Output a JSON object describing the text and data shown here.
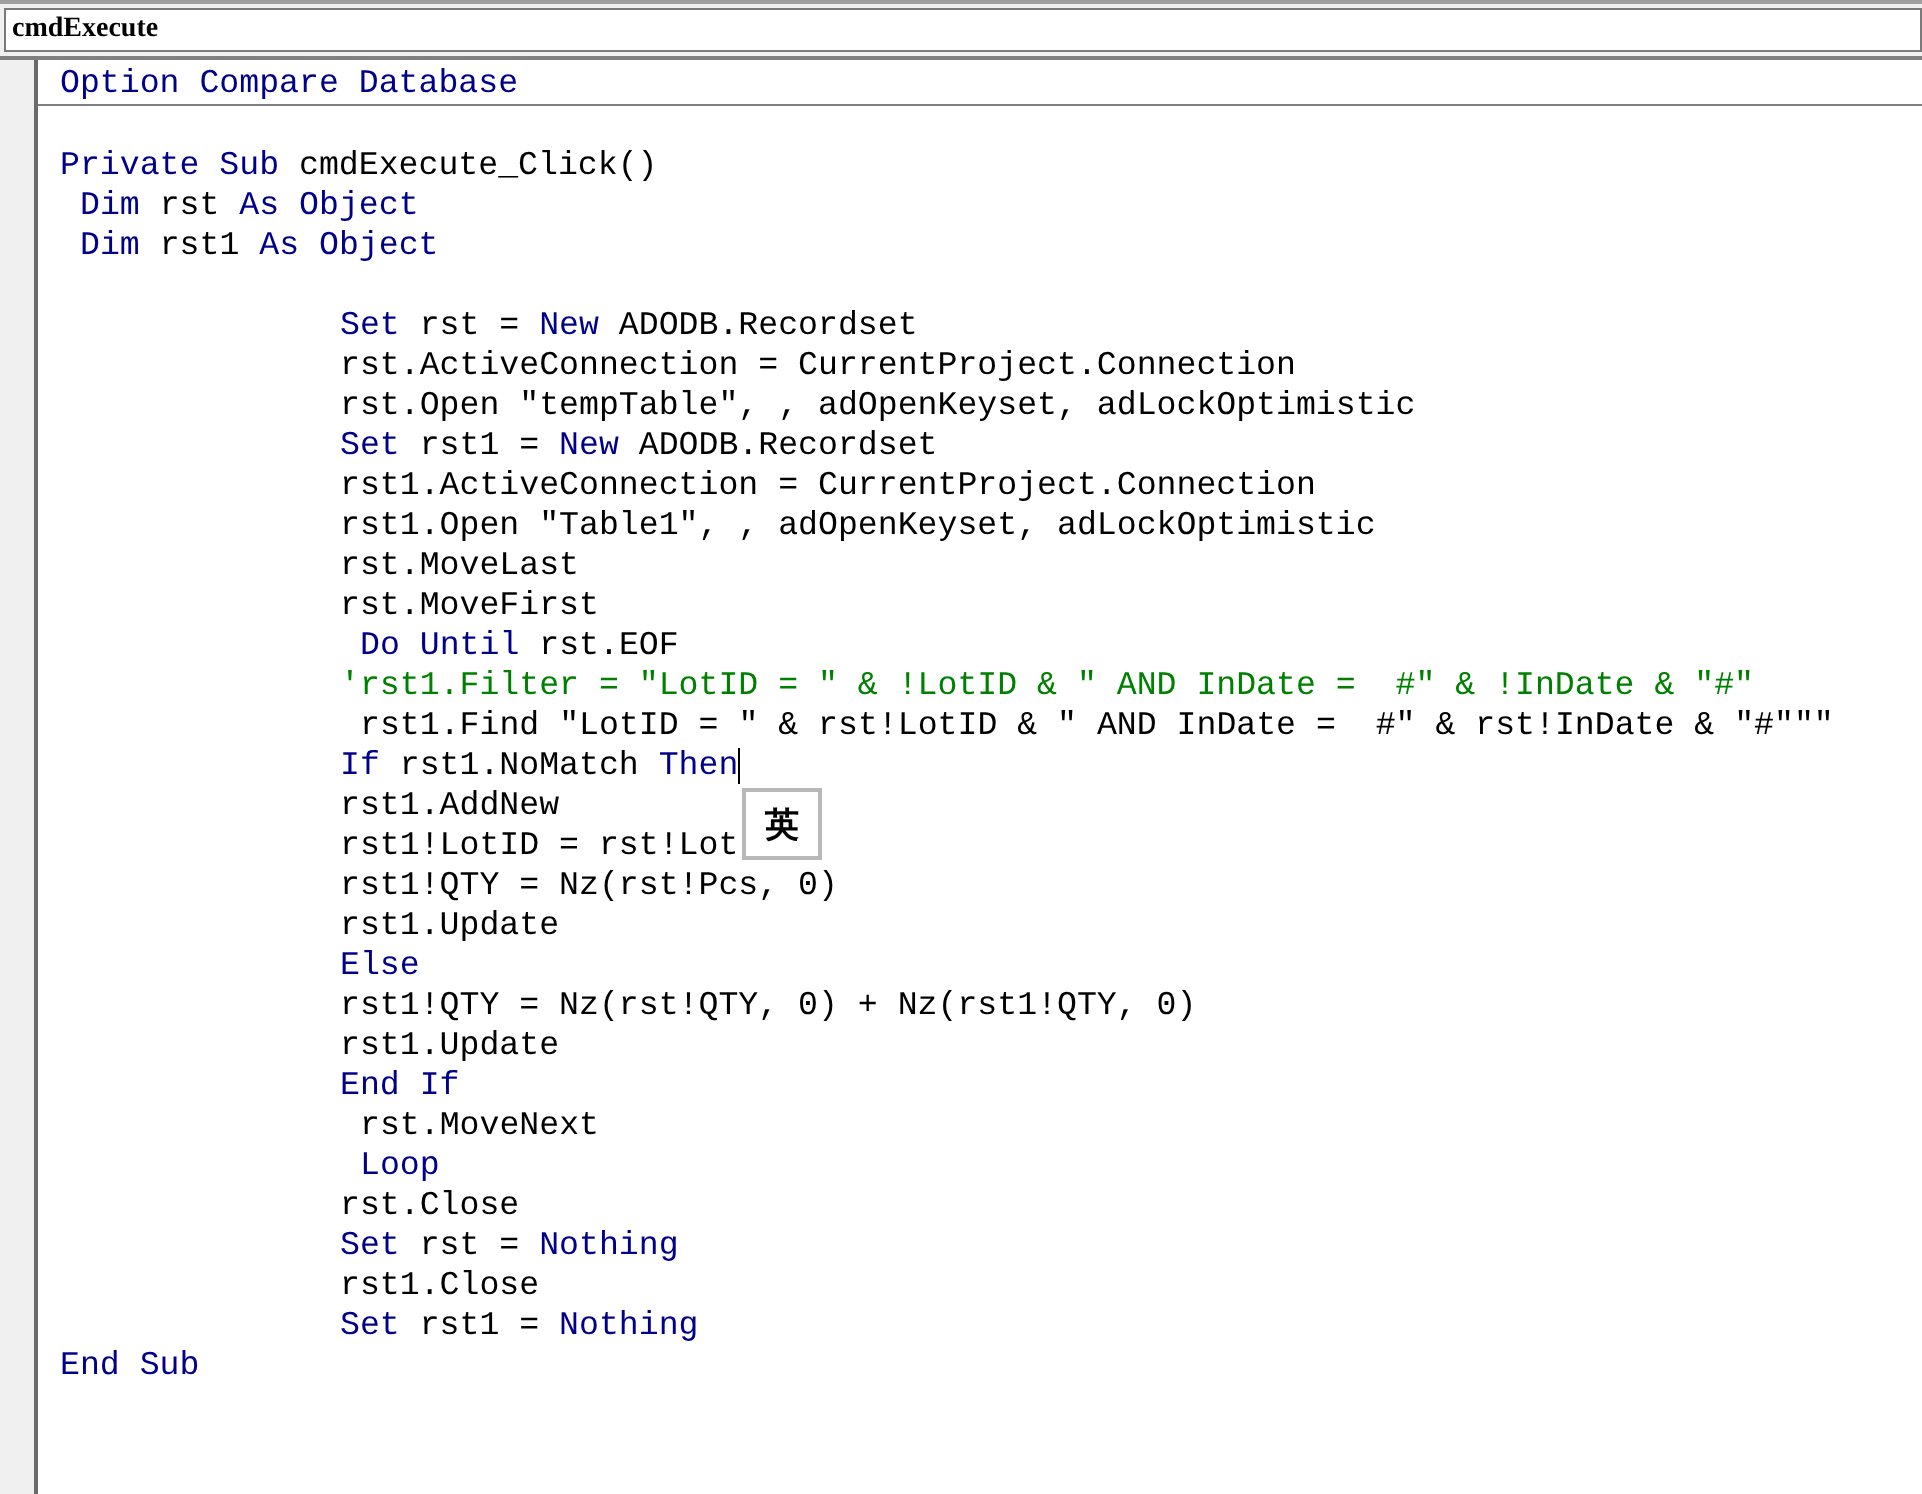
{
  "object_box": {
    "value": "cmdExecute"
  },
  "code": {
    "declarations": [
      {
        "kind": "top",
        "tokens": [
          {
            "kind": "keyword",
            "text": "Option Compare Database"
          }
        ]
      }
    ],
    "blocks": [
      {
        "lines": [
          {
            "kind": "top",
            "tokens": [
              {
                "kind": "keyword",
                "text": "Private Sub"
              },
              {
                "kind": "plain",
                "text": " cmdExecute_Click()"
              }
            ]
          },
          {
            "kind": "dim",
            "tokens": [
              {
                "kind": "keyword",
                "text": "Dim"
              },
              {
                "kind": "plain",
                "text": " rst "
              },
              {
                "kind": "keyword",
                "text": "As Object"
              }
            ]
          },
          {
            "kind": "dim",
            "tokens": [
              {
                "kind": "keyword",
                "text": "Dim"
              },
              {
                "kind": "plain",
                "text": " rst1 "
              },
              {
                "kind": "keyword",
                "text": "As Object"
              }
            ]
          }
        ]
      },
      {
        "lines": [
          {
            "kind": "body",
            "tokens": [
              {
                "kind": "keyword",
                "text": "Set"
              },
              {
                "kind": "plain",
                "text": " rst = "
              },
              {
                "kind": "keyword",
                "text": "New"
              },
              {
                "kind": "plain",
                "text": " ADODB.Recordset"
              }
            ]
          },
          {
            "kind": "body",
            "tokens": [
              {
                "kind": "plain",
                "text": "rst.ActiveConnection = CurrentProject.Connection"
              }
            ]
          },
          {
            "kind": "body",
            "tokens": [
              {
                "kind": "plain",
                "text": "rst.Open \"tempTable\", , adOpenKeyset, adLockOptimistic"
              }
            ]
          },
          {
            "kind": "body",
            "tokens": [
              {
                "kind": "keyword",
                "text": "Set"
              },
              {
                "kind": "plain",
                "text": " rst1 = "
              },
              {
                "kind": "keyword",
                "text": "New"
              },
              {
                "kind": "plain",
                "text": " ADODB.Recordset"
              }
            ]
          },
          {
            "kind": "body",
            "tokens": [
              {
                "kind": "plain",
                "text": "rst1.ActiveConnection = CurrentProject.Connection"
              }
            ]
          },
          {
            "kind": "body",
            "tokens": [
              {
                "kind": "plain",
                "text": "rst1.Open \"Table1\", , adOpenKeyset, adLockOptimistic"
              }
            ]
          },
          {
            "kind": "body",
            "tokens": [
              {
                "kind": "plain",
                "text": "rst.MoveLast"
              }
            ]
          },
          {
            "kind": "body",
            "tokens": [
              {
                "kind": "plain",
                "text": "rst.MoveFirst"
              }
            ]
          },
          {
            "kind": "loop",
            "tokens": [
              {
                "kind": "keyword",
                "text": "Do Until"
              },
              {
                "kind": "plain",
                "text": " rst.EOF"
              }
            ]
          },
          {
            "kind": "body",
            "tokens": [
              {
                "kind": "comment",
                "text": "'rst1.Filter = \"LotID = \" & !LotID & \" AND InDate =  #\" & !InDate & \"#\""
              }
            ]
          },
          {
            "kind": "loop",
            "tokens": [
              {
                "kind": "plain",
                "text": "rst1.Find \"LotID = \" & rst!LotID & \" AND InDate =  #\" & rst!InDate & \"#\"\"\""
              }
            ]
          },
          {
            "kind": "body",
            "caret": true,
            "tokens": [
              {
                "kind": "keyword",
                "text": "If"
              },
              {
                "kind": "plain",
                "text": " rst1.NoMatch "
              },
              {
                "kind": "keyword",
                "text": "Then"
              }
            ]
          },
          {
            "kind": "body",
            "tokens": [
              {
                "kind": "plain",
                "text": "rst1.AddNew"
              }
            ]
          },
          {
            "kind": "body",
            "tokens": [
              {
                "kind": "plain",
                "text": "rst1!LotID = rst!Lot"
              }
            ]
          },
          {
            "kind": "body",
            "tokens": [
              {
                "kind": "plain",
                "text": "rst1!QTY = Nz(rst!Pcs, 0)"
              }
            ]
          },
          {
            "kind": "body",
            "tokens": [
              {
                "kind": "plain",
                "text": "rst1.Update"
              }
            ]
          },
          {
            "kind": "body",
            "tokens": [
              {
                "kind": "keyword",
                "text": "Else"
              }
            ]
          },
          {
            "kind": "body",
            "tokens": [
              {
                "kind": "plain",
                "text": "rst1!QTY = Nz(rst!QTY, 0) + Nz(rst1!QTY, 0)"
              }
            ]
          },
          {
            "kind": "body",
            "tokens": [
              {
                "kind": "plain",
                "text": "rst1.Update"
              }
            ]
          },
          {
            "kind": "body",
            "tokens": [
              {
                "kind": "keyword",
                "text": "End If"
              }
            ]
          },
          {
            "kind": "loop",
            "tokens": [
              {
                "kind": "plain",
                "text": "rst.MoveNext"
              }
            ]
          },
          {
            "kind": "loop",
            "tokens": [
              {
                "kind": "keyword",
                "text": "Loop"
              }
            ]
          },
          {
            "kind": "body",
            "tokens": [
              {
                "kind": "plain",
                "text": "rst.Close"
              }
            ]
          },
          {
            "kind": "body",
            "tokens": [
              {
                "kind": "keyword",
                "text": "Set"
              },
              {
                "kind": "plain",
                "text": " rst = "
              },
              {
                "kind": "keyword",
                "text": "Nothing"
              }
            ]
          },
          {
            "kind": "body",
            "tokens": [
              {
                "kind": "plain",
                "text": "rst1.Close"
              }
            ]
          },
          {
            "kind": "body",
            "tokens": [
              {
                "kind": "keyword",
                "text": "Set"
              },
              {
                "kind": "plain",
                "text": " rst1 = "
              },
              {
                "kind": "keyword",
                "text": "Nothing"
              }
            ]
          },
          {
            "kind": "top",
            "tokens": [
              {
                "kind": "keyword",
                "text": "End Sub"
              }
            ]
          }
        ]
      }
    ]
  },
  "ime_indicator": {
    "text": "英"
  }
}
